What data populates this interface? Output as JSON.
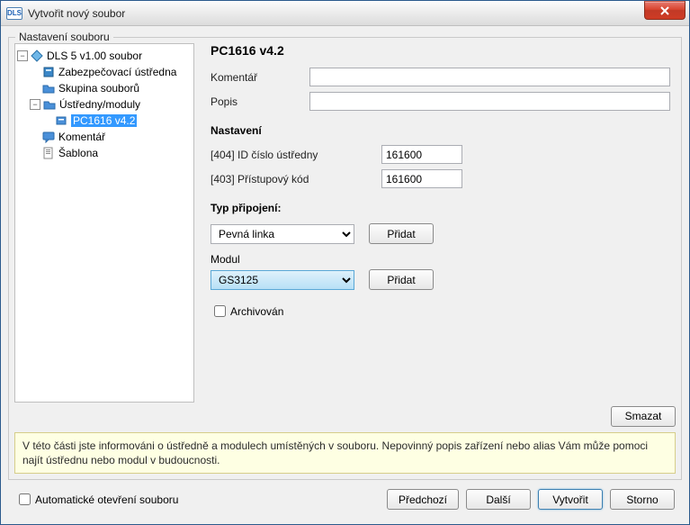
{
  "window": {
    "logo_text": "DLS",
    "title": "Vytvořit nový soubor"
  },
  "group": {
    "legend": "Nastavení souboru"
  },
  "tree": {
    "root": "DLS 5 v1.00 soubor",
    "n1": "Zabezpečovací ústředna",
    "n2": "Skupina souborů",
    "n3": "Ústředny/moduly",
    "n3a": "PC1616 v4.2",
    "n4": "Komentář",
    "n5": "Šablona"
  },
  "form": {
    "title": "PC1616 v4.2",
    "comment_label": "Komentář",
    "comment_value": "",
    "desc_label": "Popis",
    "desc_value": "",
    "settings_heading": "Nastavení",
    "id_label": "[404]  ID číslo ústředny",
    "id_value": "161600",
    "code_label": "[403]  Přístupový kód",
    "code_value": "161600",
    "conn_heading": "Typ připojení:",
    "conn_value": "Pevná linka",
    "add1": "Přidat",
    "module_label": "Modul",
    "module_value": "GS3125",
    "add2": "Přidat",
    "archived_label": "Archivován",
    "delete": "Smazat"
  },
  "info": "V této části jste informováni o ústředně a modulech umístěných v souboru. Nepovinný popis zařízení nebo alias Vám může pomoci najít ústřednu nebo modul v budoucnosti.",
  "footer": {
    "auto_open": "Automatické otevření souboru",
    "prev": "Předchozí",
    "next": "Další",
    "create": "Vytvořit",
    "cancel": "Storno"
  }
}
